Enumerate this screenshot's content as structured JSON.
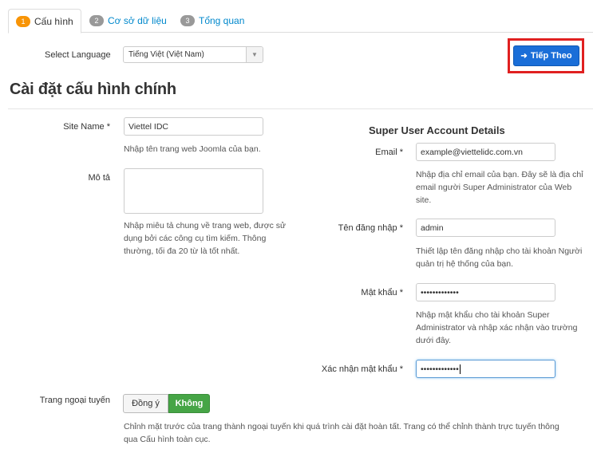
{
  "tabs": [
    {
      "num": "1",
      "label": "Cấu hình"
    },
    {
      "num": "2",
      "label": "Cơ sở dữ liệu"
    },
    {
      "num": "3",
      "label": "Tổng quan"
    }
  ],
  "language": {
    "label": "Select Language",
    "value": "Tiếng Việt (Việt Nam)"
  },
  "next_button": {
    "label": "Tiếp Theo"
  },
  "page_title": "Cài đặt cấu hình chính",
  "site_name": {
    "label": "Site Name *",
    "value": "Viettel IDC",
    "help": "Nhập tên trang web Joomla của bạn."
  },
  "description": {
    "label": "Mô tả",
    "value": "",
    "help": "Nhập miêu tả chung về trang web, được sử dụng bởi các công cụ tìm kiếm. Thông thường, tối đa 20 từ là tốt nhất."
  },
  "super_user": {
    "title": "Super User Account Details",
    "email": {
      "label": "Email *",
      "value": "example@viettelidc.com.vn",
      "help": "Nhập địa chỉ email của bạn. Đây sẽ là địa chỉ email người Super Administrator của Web site."
    },
    "username": {
      "label": "Tên đăng nhập *",
      "value": "admin",
      "help": "Thiết lập tên đăng nhập cho tài khoản Người quản trị hệ thống của bạn."
    },
    "password": {
      "label": "Mật khẩu *",
      "value": "•••••••••••••",
      "help": "Nhập mật khẩu cho tài khoản Super Administrator và nhập xác nhận vào trường dưới đây."
    },
    "confirm": {
      "label": "Xác nhận mật khẩu *",
      "value": "•••••••••••••"
    }
  },
  "offline": {
    "label": "Trang ngoại tuyến",
    "yes": "Đồng ý",
    "no": "Không",
    "selected": "Không",
    "help": "Chỉnh mặt trước của trang thành ngoại tuyến khi quá trình cài đặt hoàn tất. Trang có thể chỉnh thành trực tuyến thông qua Cấu hình toàn cục."
  },
  "colors": {
    "accent": "#1a6ed8",
    "highlight": "#e02020",
    "active_tab_badge": "#f89406",
    "toggle_on": "#46a546"
  }
}
